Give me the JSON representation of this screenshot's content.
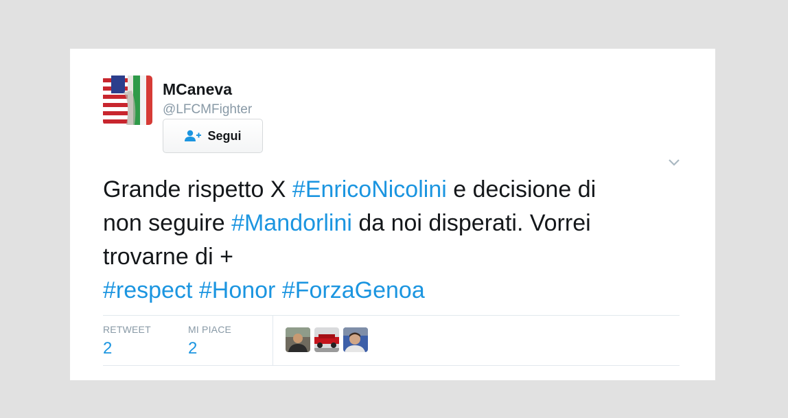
{
  "tweet": {
    "author": {
      "display_name": "MCaneva",
      "screen_name": "@LFCMFighter",
      "avatar_icon": "flags-avatar-icon"
    },
    "follow_button": {
      "label": "Segui",
      "icon": "add-user-icon"
    },
    "menu_icon": "chevron-down-icon",
    "text": {
      "line1_a": "Grande rispetto X ",
      "line1_hashtag": "#EnricoNicolini",
      "line1_b": " e decisione di",
      "line2_a": "non seguire ",
      "line2_hashtag": "#Mandorlini",
      "line2_b": " da noi disperati. Vorrei",
      "line3": "trovarne di +",
      "hashtags": [
        "#respect",
        "#Honor",
        "#ForzaGenoa"
      ]
    },
    "stats": {
      "retweet_label": "RETWEET",
      "retweet_count": "2",
      "like_label": "MI PIACE",
      "like_count": "2"
    },
    "likers": [
      "user-avatar-1",
      "user-avatar-2",
      "user-avatar-3"
    ]
  },
  "colors": {
    "hashtag": "#1b95e0",
    "text": "#14171a",
    "muted": "#8899a6",
    "background": "#e1e1e1",
    "card": "#ffffff"
  }
}
